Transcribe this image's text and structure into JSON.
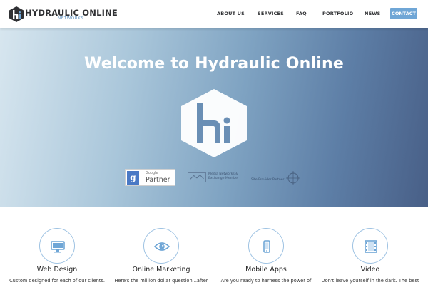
{
  "brand": {
    "title": "HYDRAULIC ONLINE",
    "subtitle": "NETWORKS",
    "icon": "hi-hexagon-icon"
  },
  "nav": {
    "items": [
      "ABOUT US",
      "SERVICES",
      "FAQ",
      "PORTFOLIO",
      "NEWS"
    ],
    "contact": "CONTACT"
  },
  "hero": {
    "title": "Welcome to Hydraulic Online",
    "logo_icon": "hi-hexagon-icon",
    "badges": {
      "google_small": "Google",
      "google_big": "Partner",
      "google_letter": "g",
      "media_text_line1": "Media Networks &",
      "media_text_line2": "Exchange Member",
      "third_text": "Site Provider Partner"
    }
  },
  "services": [
    {
      "title": "Web Design",
      "desc": "Custom designed for each of our clients.",
      "icon": "monitor-icon"
    },
    {
      "title": "Online Marketing",
      "desc": "Here's the million dollar question...after",
      "icon": "eye-icon"
    },
    {
      "title": "Mobile Apps",
      "desc": "Are you ready to harness the power of",
      "icon": "mobile-phone-icon"
    },
    {
      "title": "Video",
      "desc": "Don't leave yourself in the dark. The best",
      "icon": "film-icon"
    }
  ],
  "colors": {
    "accent": "#6fa6d6",
    "hero_left": "#d7e6ef",
    "hero_right": "#485f87",
    "text_dark": "#2f3033"
  }
}
